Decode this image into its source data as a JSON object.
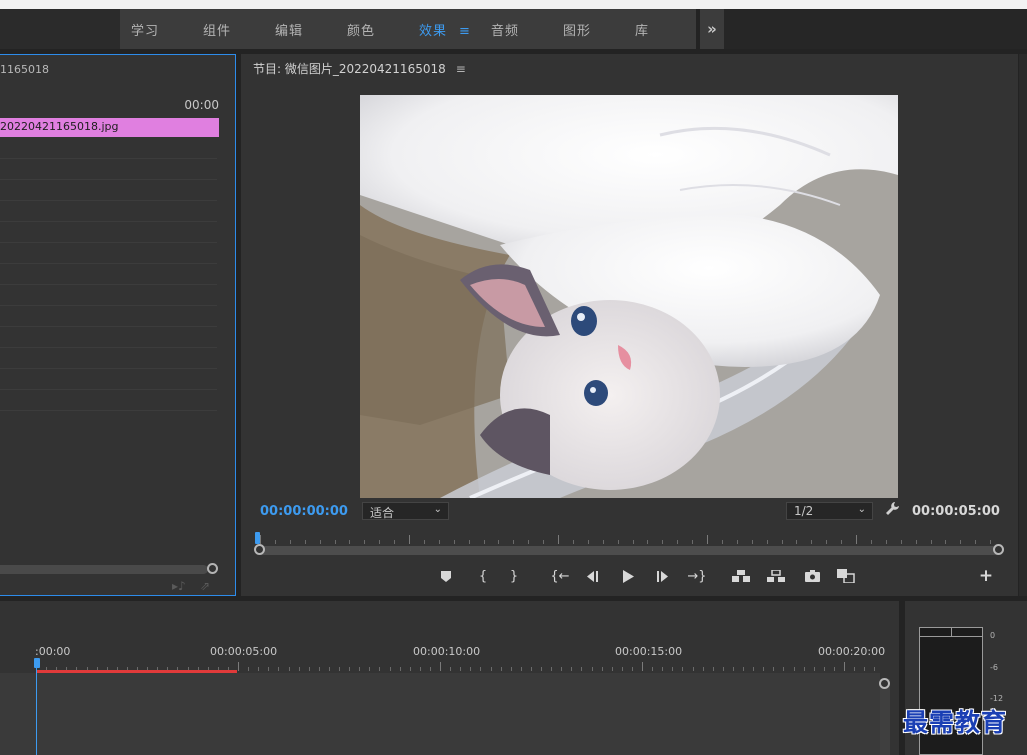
{
  "workspace": {
    "tabs": [
      {
        "label": "学习"
      },
      {
        "label": "组件"
      },
      {
        "label": "编辑"
      },
      {
        "label": "颜色"
      },
      {
        "label": "效果",
        "active": true
      },
      {
        "label": "音频"
      },
      {
        "label": "图形"
      },
      {
        "label": "库"
      }
    ],
    "menu_glyph": "≡",
    "more_glyph": "»"
  },
  "source": {
    "title": "1165018",
    "timecode": "00:00",
    "clip_name": "20220421165018.jpg",
    "clip_color": "#e07fe0"
  },
  "program": {
    "title": "节目: 微信图片_20220421165018",
    "menu_glyph": "≡",
    "timecode_current": "00:00:00:00",
    "timecode_duration": "00:00:05:00",
    "fit": "适合",
    "resolution": "1/2",
    "controls": [
      {
        "name": "add-marker",
        "glyph": "⬟"
      },
      {
        "name": "mark-in",
        "glyph": "{"
      },
      {
        "name": "mark-out",
        "glyph": "}"
      },
      {
        "name": "go-to-in",
        "glyph": "{←"
      },
      {
        "name": "step-back",
        "glyph": "◂|"
      },
      {
        "name": "play",
        "glyph": "▶"
      },
      {
        "name": "step-forward",
        "glyph": "|▸"
      },
      {
        "name": "go-to-out",
        "glyph": "→}"
      },
      {
        "name": "lift",
        "glyph": "⏏"
      },
      {
        "name": "extract",
        "glyph": "⏏"
      },
      {
        "name": "export-frame",
        "glyph": "📷"
      },
      {
        "name": "comparison-view",
        "glyph": "⧉"
      }
    ],
    "add_glyph": "+"
  },
  "timeline": {
    "labels": [
      ":00:00",
      "00:00:05:00",
      "00:00:10:00",
      "00:00:15:00",
      "00:00:20:00"
    ],
    "in_out_color": "#e03a3a",
    "playhead_color": "#3d9bf0"
  },
  "meter": {
    "db_labels": [
      "0",
      "-6",
      "-12"
    ]
  },
  "watermark": "最需教育",
  "colors": {
    "accent": "#3d9bf0",
    "panel": "#333333",
    "background": "#232323"
  }
}
